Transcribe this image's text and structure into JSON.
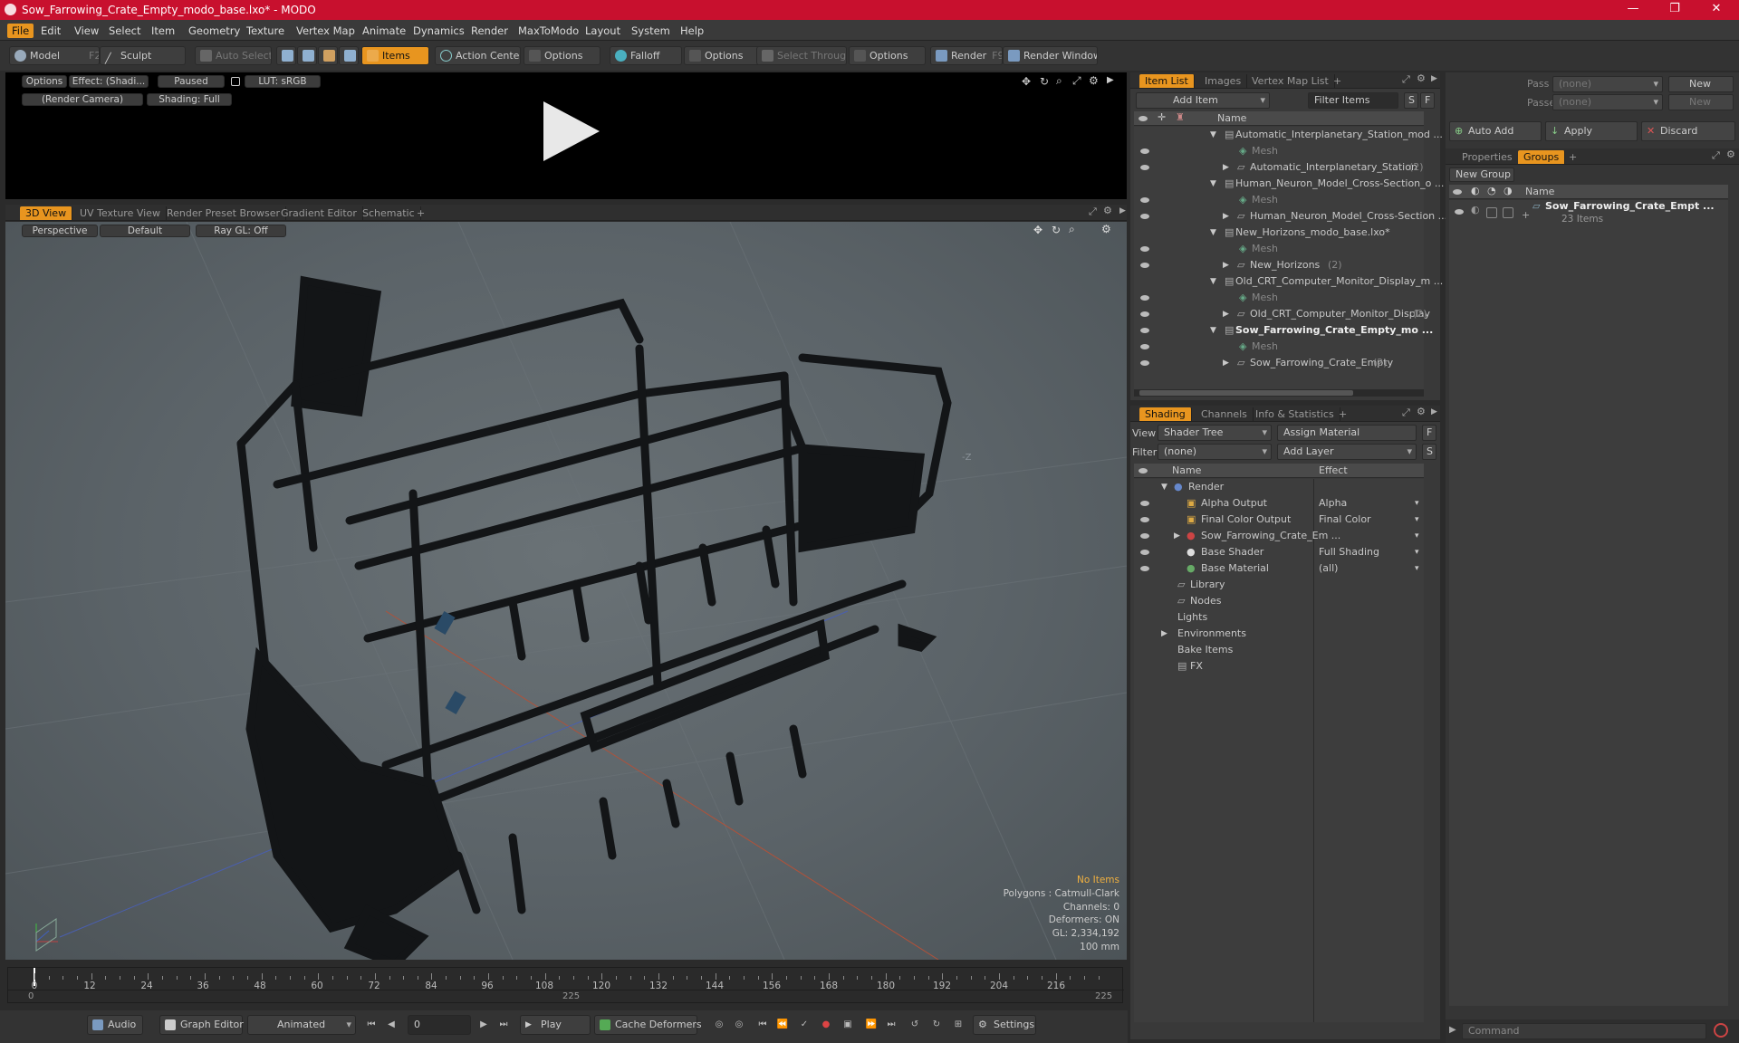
{
  "window": {
    "title": "Sow_Farrowing_Crate_Empty_modo_base.lxo* - MODO",
    "minimize": "—",
    "maximize": "❐",
    "close": "✕"
  },
  "menu": [
    "File",
    "Edit",
    "View",
    "Select",
    "Item",
    "Geometry",
    "Texture",
    "Vertex Map",
    "Animate",
    "Dynamics",
    "Render",
    "MaxToModo",
    "Layout",
    "System",
    "Help"
  ],
  "toolbar": {
    "model": "Model",
    "model_key": "F2",
    "sculpt": "Sculpt",
    "auto_select": "Auto Select",
    "items": "Items",
    "action_center": "Action Center",
    "options1": "Options",
    "falloff": "Falloff",
    "options2": "Options",
    "select_through": "Select Through",
    "options3": "Options",
    "render": "Render",
    "render_key": "F9",
    "render_window": "Render Window"
  },
  "preview": {
    "options": "Options",
    "effect": "Effect: (Shadi...",
    "paused": "Paused",
    "lut": "LUT: sRGB",
    "camera": "(Render Camera)",
    "shading": "Shading: Full"
  },
  "viewport_tabs": [
    "3D View",
    "UV Texture View",
    "Render Preset Browser",
    "Gradient Editor",
    "Schematic",
    "+"
  ],
  "viewport": {
    "perspective": "Perspective",
    "default": "Default",
    "raygl": "Ray GL: Off",
    "axis_label": "-Z",
    "hud": [
      "No Items",
      "Polygons : Catmull-Clark",
      "Channels: 0",
      "Deformers: ON",
      "GL: 2,334,192",
      "100 mm"
    ]
  },
  "item_list": {
    "tabs": [
      "Item List",
      "Images",
      "Vertex Map List",
      "+"
    ],
    "add_item": "Add Item",
    "filter_items": "Filter Items",
    "s": "S",
    "f": "F",
    "col_name": "Name",
    "rows": [
      {
        "label": "Automatic_Interplanetary_Station_mod ...",
        "bold": false
      },
      {
        "label": "Mesh",
        "bold": false
      },
      {
        "label": "Automatic_Interplanetary_Station",
        "count": "(2)",
        "bold": false
      },
      {
        "label": "Human_Neuron_Model_Cross-Section_o ...",
        "bold": false
      },
      {
        "label": "Mesh",
        "bold": false
      },
      {
        "label": "Human_Neuron_Model_Cross-Section ...",
        "bold": false
      },
      {
        "label": "New_Horizons_modo_base.lxo*",
        "bold": false
      },
      {
        "label": "Mesh",
        "bold": false
      },
      {
        "label": "New_Horizons",
        "count": "(2)",
        "bold": false
      },
      {
        "label": "Old_CRT_Computer_Monitor_Display_m ...",
        "bold": false
      },
      {
        "label": "Mesh",
        "bold": false
      },
      {
        "label": "Old_CRT_Computer_Monitor_Display",
        "count": "(2)",
        "bold": false
      },
      {
        "label": "Sow_Farrowing_Crate_Empty_mo ...",
        "bold": true
      },
      {
        "label": "Mesh",
        "bold": false
      },
      {
        "label": "Sow_Farrowing_Crate_Empty",
        "count": "(2)",
        "bold": false
      }
    ]
  },
  "shading": {
    "tabs": [
      "Shading",
      "Channels",
      "Info & Statistics",
      "+"
    ],
    "view_label": "View",
    "view_value": "Shader Tree",
    "assign_material": "Assign Material",
    "filter_label": "Filter",
    "filter_value": "(none)",
    "add_layer": "Add Layer",
    "f": "F",
    "s": "S",
    "col_name": "Name",
    "col_effect": "Effect",
    "rows": [
      {
        "label": "Render",
        "effect": ""
      },
      {
        "label": "Alpha Output",
        "effect": "Alpha"
      },
      {
        "label": "Final Color Output",
        "effect": "Final Color"
      },
      {
        "label": "Sow_Farrowing_Crate_Em ...",
        "effect": ""
      },
      {
        "label": "Base Shader",
        "effect": "Full Shading"
      },
      {
        "label": "Base Material",
        "effect": "(all)"
      },
      {
        "label": "Library",
        "effect": ""
      },
      {
        "label": "Nodes",
        "effect": ""
      },
      {
        "label": "Lights",
        "effect": ""
      },
      {
        "label": "Environments",
        "effect": ""
      },
      {
        "label": "Bake Items",
        "effect": ""
      },
      {
        "label": "FX",
        "effect": ""
      }
    ]
  },
  "right": {
    "pass_groups": "Pass Groups",
    "pass_groups_value": "(none)",
    "new": "New",
    "passes": "Passes",
    "passes_value": "(none)",
    "new2": "New",
    "auto_add": "Auto Add",
    "apply": "Apply",
    "discard": "Discard",
    "tabs": [
      "Properties",
      "Groups",
      "+"
    ],
    "new_group": "New Group",
    "col_name": "Name",
    "group_name": "Sow_Farrowing_Crate_Empt ...",
    "group_items": "23 Items",
    "command_placeholder": "Command"
  },
  "timeline": {
    "labels": [
      "0",
      "12",
      "24",
      "36",
      "48",
      "60",
      "72",
      "84",
      "96",
      "108",
      "120",
      "132",
      "144",
      "156",
      "168",
      "180",
      "192",
      "204",
      "216"
    ],
    "start": "0",
    "mid": "225",
    "end": "225"
  },
  "bottom": {
    "audio": "Audio",
    "graph_editor": "Graph Editor",
    "animated": "Animated",
    "frame": "0",
    "play": "Play",
    "cache_deformers": "Cache Deformers",
    "settings": "Settings"
  },
  "colors": {
    "accent": "#e8951f",
    "titlebar": "#c8102e",
    "viewport_bg": "#5b6368"
  }
}
